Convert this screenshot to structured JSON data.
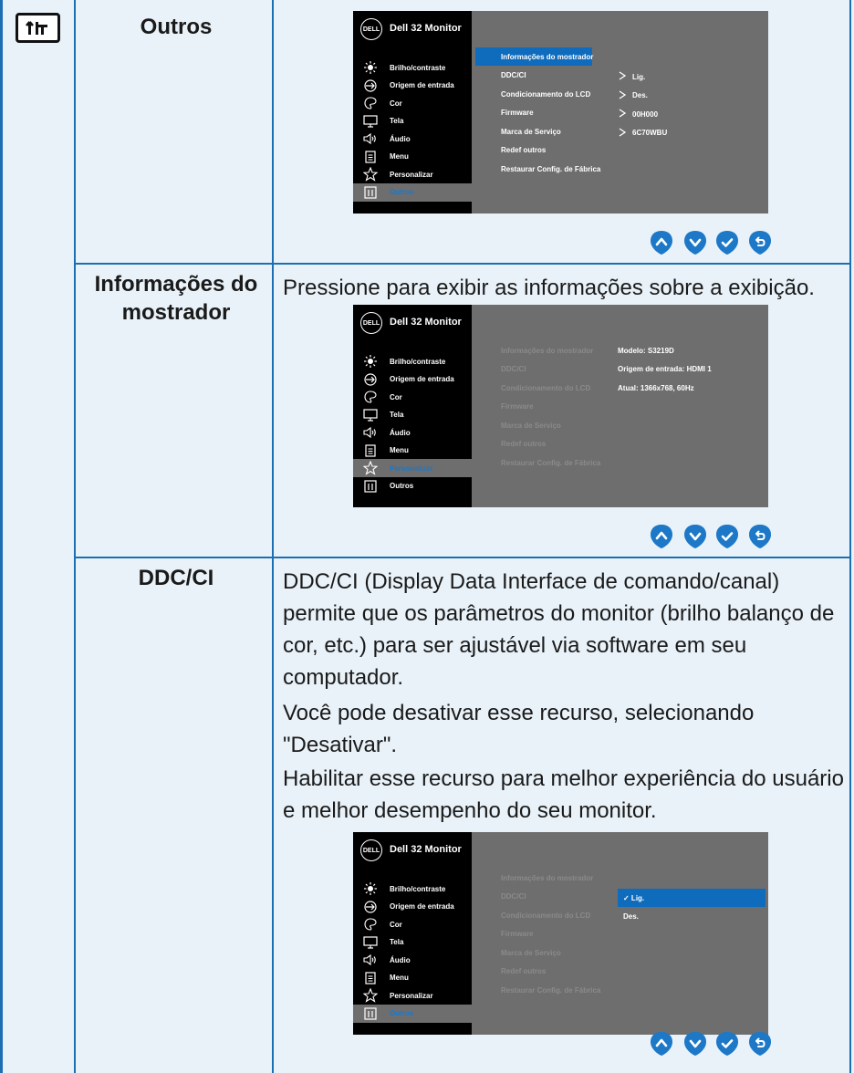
{
  "rows": [
    {
      "label": "Outros",
      "desc": []
    },
    {
      "label": "Informações do mostrador",
      "desc": [
        "Pressione para exibir as informações sobre a exibição."
      ]
    },
    {
      "label": "DDC/CI",
      "desc": [
        "DDC/CI (Display Data Interface de comando/canal) permite que os parâmetros do monitor (brilho balanço de cor, etc.) para ser ajustável via software em seu computador.",
        "Você pode desativar esse recurso, selecionando \"Desativar\".",
        "Habilitar esse recurso para melhor experiência do usuário e melhor desempenho do seu monitor."
      ]
    }
  ],
  "osd": {
    "logo": "DELL",
    "title": "Dell 32 Monitor",
    "menu": [
      "Brilho/contraste",
      "Origem de entrada",
      "Cor",
      "Tela",
      "Áudio",
      "Menu",
      "Personalizar",
      "Outros"
    ],
    "submenu": [
      "Informações do mostrador",
      "DDC/CI",
      "Condicionamento do LCD",
      "Firmware",
      "Marca de Serviço",
      "Redef outros",
      "Restaurar Config. de Fábrica"
    ],
    "values1": [
      "Lig.",
      "Des.",
      "00H000",
      "6C70WBU"
    ],
    "info2": [
      "Modelo: S3219D",
      "Origem de entrada: HDMI 1",
      "Atual: 1366x768, 60Hz"
    ],
    "options3": [
      "✓ Lig.",
      "Des."
    ]
  },
  "nav_buttons": [
    "up-icon",
    "down-icon",
    "check-icon",
    "back-icon"
  ],
  "colors": {
    "grid": "#1d6fb3",
    "page": "#e9f2f9",
    "highlight": "#0f6cbd",
    "button": "#1d78c7"
  }
}
